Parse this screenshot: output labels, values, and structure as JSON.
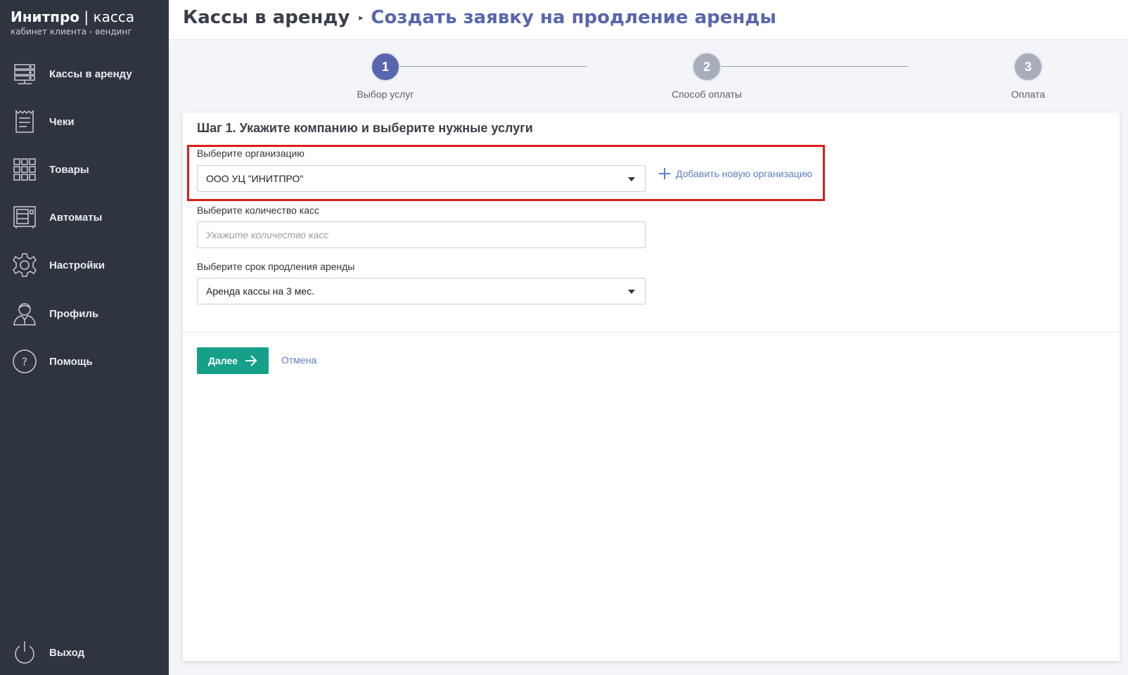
{
  "brand": {
    "title_bold": "Инитпро",
    "title_sep": " | ",
    "title_light": "касса",
    "subtitle": "кабинет клиента - вендинг"
  },
  "sidebar": {
    "items": [
      {
        "label": "Кассы в аренду",
        "icon": "server-rack-icon"
      },
      {
        "label": "Чеки",
        "icon": "receipt-icon"
      },
      {
        "label": "Товары",
        "icon": "grid-icon"
      },
      {
        "label": "Автоматы",
        "icon": "vending-machine-icon"
      },
      {
        "label": "Настройки",
        "icon": "gear-icon"
      },
      {
        "label": "Профиль",
        "icon": "user-icon"
      },
      {
        "label": "Помощь",
        "icon": "help-icon"
      }
    ],
    "logout": {
      "label": "Выход",
      "icon": "power-icon"
    }
  },
  "header": {
    "breadcrumb_root": "Кассы в аренду",
    "breadcrumb_current": "Создать заявку на продление аренды"
  },
  "stepper": {
    "steps": [
      {
        "number": "1",
        "label": "Выбор услуг",
        "state": "active"
      },
      {
        "number": "2",
        "label": "Способ оплаты",
        "state": "inactive"
      },
      {
        "number": "3",
        "label": "Оплата",
        "state": "inactive"
      }
    ]
  },
  "form": {
    "title": "Шаг 1. Укажите компанию и выберите нужные услуги",
    "organization": {
      "label": "Выберите организацию",
      "value": "ООО УЦ \"ИНИТПРО\"",
      "add_link": "Добавить новую организацию"
    },
    "quantity": {
      "label": "Выберите количество касс",
      "placeholder": "Укажите количество касс",
      "value": ""
    },
    "term": {
      "label": "Выберите срок продления аренды",
      "value": "Аренда кассы на 3 мес."
    },
    "next_button": "Далее",
    "cancel_link": "Отмена"
  },
  "colors": {
    "sidebar_bg": "#2f3441",
    "accent": "#5866ae",
    "primary_button": "#16a089",
    "link": "#5b7ec0",
    "highlight": "#dd1c1c"
  }
}
